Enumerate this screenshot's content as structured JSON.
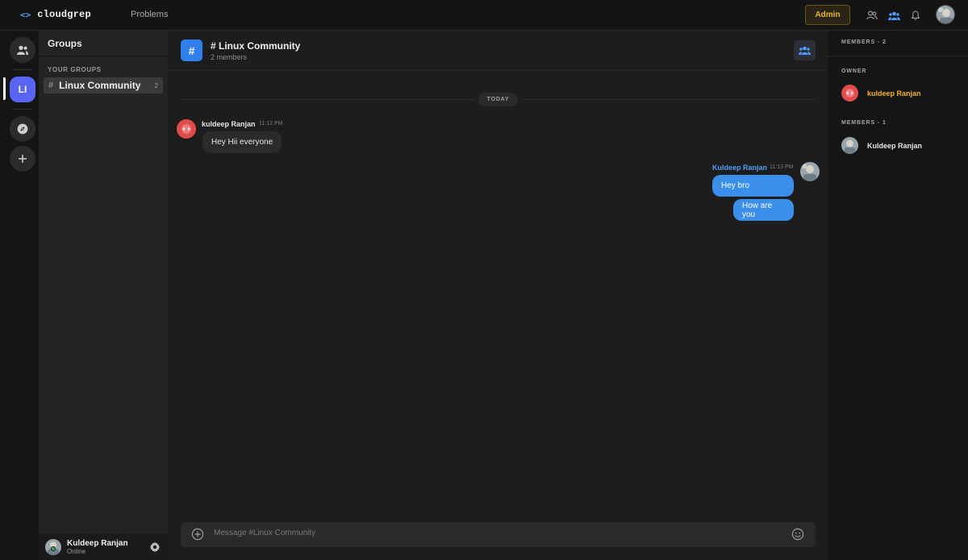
{
  "app": {
    "logo_mark": "<>",
    "logo_text": "cloudgrep",
    "nav_problems": "Problems",
    "admin_label": "Admin"
  },
  "icons": {
    "friends": "people-outline-icon",
    "groups": "people-filled-icon",
    "bell": "bell-icon"
  },
  "rail": {
    "active_initials": "LI"
  },
  "groups": {
    "header": "Groups",
    "section_label": "YOUR GROUPS",
    "items": [
      {
        "name": "Linux Community",
        "count": "2"
      }
    ]
  },
  "user": {
    "name": "Kuldeep Ranjan",
    "status": "Online"
  },
  "channel": {
    "title": "# Linux Community",
    "members_label": "2 members",
    "icon_glyph": "#"
  },
  "chat": {
    "day_label": "TODAY",
    "incoming": {
      "author": "kuldeep Ranjan",
      "time": "11:12 PM",
      "text": "Hey Hii everyone"
    },
    "outgoing": {
      "author": "Kuldeep Ranjan",
      "time": "11:13 PM",
      "texts": [
        "Hey bro",
        "How are you"
      ]
    }
  },
  "composer": {
    "placeholder": "Message #Linux Community"
  },
  "members_panel": {
    "header": "MEMBERS - 2",
    "owner_label": "OWNER",
    "owner": {
      "name": "kuldeep Ranjan",
      "color": "#f0b429"
    },
    "members_label": "MEMBERS - 1",
    "members": [
      {
        "name": "Kuldeep Ranjan",
        "color": "#e6e6e6"
      }
    ]
  },
  "colors": {
    "accent": "#5865f2",
    "outgoing_bubble": "#3b8eea",
    "admin": "#f0b429",
    "owner_avatar": "#e04b4b"
  }
}
